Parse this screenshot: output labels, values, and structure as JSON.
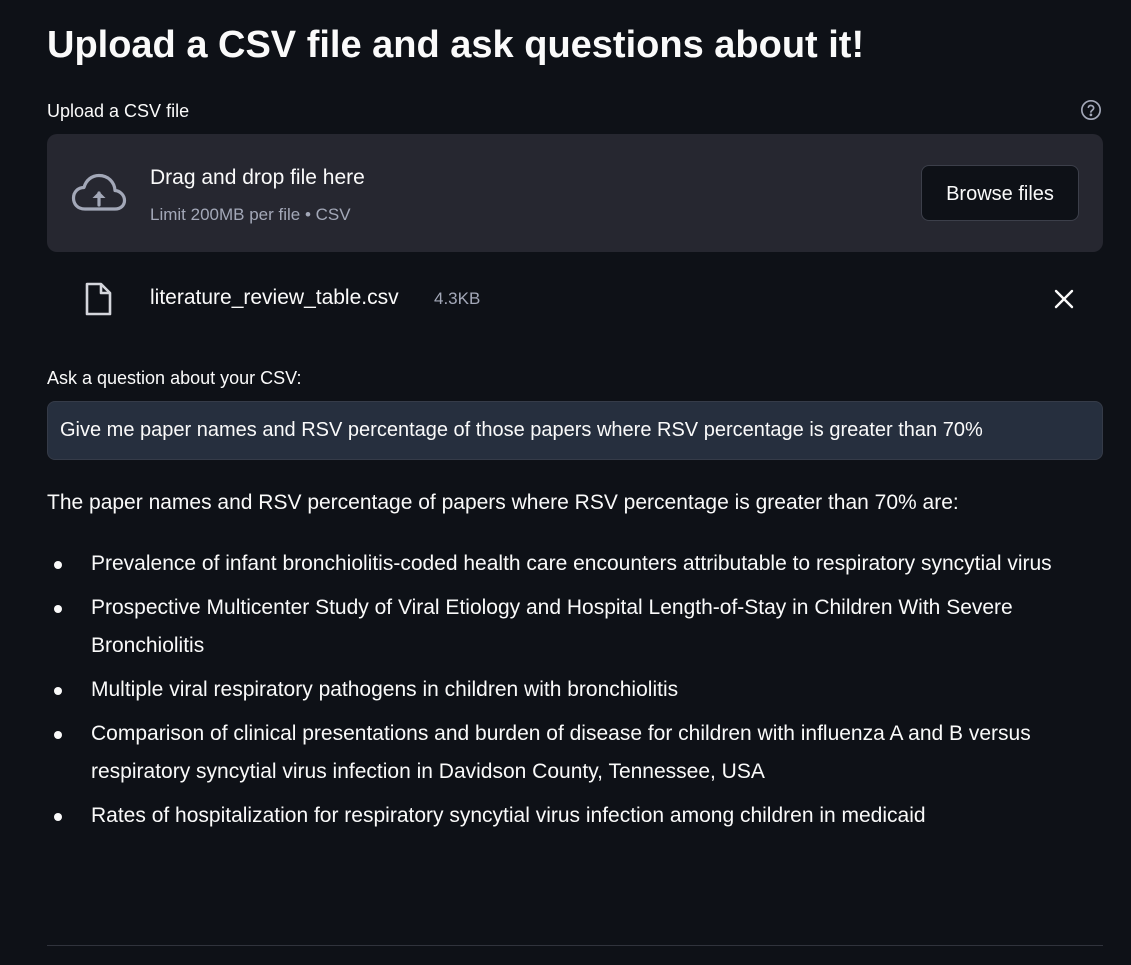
{
  "page": {
    "title": "Upload a CSV file and ask questions about it!"
  },
  "uploader": {
    "label": "Upload a CSV file",
    "help_icon": "question-circle-icon",
    "drop_title": "Drag and drop file here",
    "drop_limit": "Limit 200MB per file • CSV",
    "browse_label": "Browse files",
    "upload_icon": "cloud-upload-icon"
  },
  "uploaded_file": {
    "name": "literature_review_table.csv",
    "size": "4.3KB",
    "icon": "file-icon",
    "remove_icon": "close-icon"
  },
  "question": {
    "label": "Ask a question about your CSV:",
    "value": "Give me paper names and RSV percentage of those papers where RSV percentage is greater than 70%"
  },
  "answer": {
    "intro": "The paper names and RSV percentage of papers where RSV percentage is greater than 70% are:",
    "items": [
      "Prevalence of infant bronchiolitis-coded health care encounters attributable to respiratory syncytial virus",
      "Prospective Multicenter Study of Viral Etiology and Hospital Length-of-Stay in Children With Severe Bronchiolitis",
      "Multiple viral respiratory pathogens in children with bronchiolitis",
      "Comparison of clinical presentations and burden of disease for children with influenza A and B versus respiratory syncytial virus infection in Davidson County, Tennessee, USA",
      "Rates of hospitalization for respiratory syncytial virus infection among children in medicaid"
    ]
  },
  "colors": {
    "background": "#0e1117",
    "panel": "#262730",
    "input_background": "#262f3e",
    "text": "#fafafa",
    "muted_text": "#a3a8b8"
  }
}
